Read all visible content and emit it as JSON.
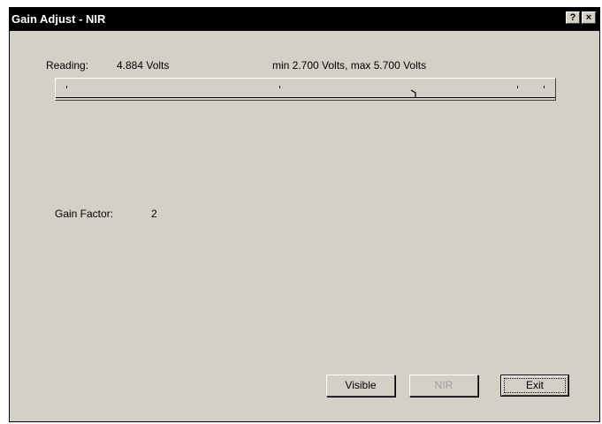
{
  "window": {
    "title": "Gain Adjust - NIR",
    "help_label": "?",
    "close_label": "×"
  },
  "reading": {
    "label": "Reading:",
    "value": "4.884 Volts",
    "range_text": "min 2.700 Volts,  max 5.700 Volts"
  },
  "slider": {
    "min": 2.7,
    "max": 5.7,
    "value": 4.884
  },
  "gain": {
    "label": "Gain Factor:",
    "value": "2"
  },
  "buttons": {
    "visible_label": "Visible",
    "nir_label": "NIR",
    "exit_label": "Exit"
  }
}
